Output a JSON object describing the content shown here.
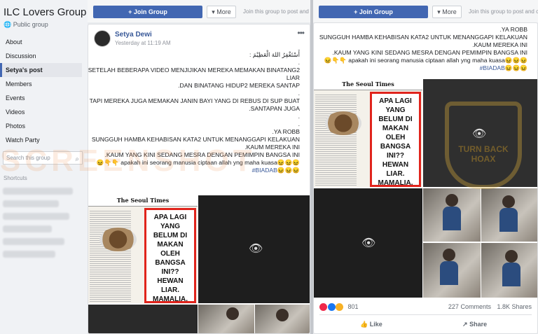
{
  "sidebar": {
    "group_title": "ILC Lovers Group",
    "public_label": "Public group",
    "nav": [
      "About",
      "Discussion",
      "Setya's post",
      "Members",
      "Events",
      "Videos",
      "Photos",
      "Watch Party"
    ],
    "search_placeholder": "Search this group",
    "shortcuts_label": "Shortcuts"
  },
  "topbar": {
    "join_label": "+ Join Group",
    "more_label": "More",
    "join_note": "Join this group to post and co"
  },
  "post": {
    "author": "Setya Dewi",
    "time": "Yesterday at 11:19 AM",
    "lines": [
      ": أَسْتَغْفِرُ اللهَ الْعَظِيْمَ",
      ".",
      "SETELAH BEBERAPA VIDEO MENJIJIKAN MEREKA MEMAKAN BINATANG2",
      "LIAR",
      ".DAN BINATANG HIDUP2 MEREKA SANTAP",
      ".",
      "TAPI MEREKA JUGA MEMAKAN JANIN BAYI YANG DI REBUS DI SUP BUAT",
      ".SANTAPAN JUGA",
      ".",
      ".",
      ".YA ROBB",
      "SUNGGUH HAMBA KEHABISAN KATA2 UNTUK MENANGGAPI KELAKUAN",
      ".KAUM MEREKA INI",
      ".KAUM YANG KINI SEDANG MESRA DENGAN PEMIMPIN BANGSA INI",
      "😖👇👇 apakah ini seorang manusia ciptaan allah yng maha kuasa😖😖😖",
      "#BIADAB😖😖😖"
    ],
    "right_lines": [
      ".YA ROBB",
      "SUNGGUH HAMBA KEHABISAN KATA2 UNTUK MENANGGAPI KELAKUAN",
      ".KAUM MEREKA INI",
      ".KAUM YANG KINI SEDANG MESRA DENGAN PEMIMPIN BANGSA INI",
      "😖👇👇 apakah ini seorang manusia ciptaan allah yng maha kuasa😖😖😖",
      "#BIADAB😖😖😖"
    ],
    "image_masthead": "The Seoul Times",
    "image_caption": "APA LAGI YANG BELUM DI MAKAN OLEH BANGSA INI?? HEWAN LIAR. MAMALIA. KINI JANIN CALON ANAK MANUSIA JUGA DI SANTAPNYA",
    "reaction_count": "801",
    "comments": "227 Comments",
    "shares": "1.8K Shares",
    "like_label": "Like",
    "share_label": "Share"
  },
  "overlays": {
    "watermark": "SCREENSHOT",
    "stamp_text": "TURN BACK HOAX"
  },
  "colors": {
    "brand": "#4267b2",
    "link": "#385898",
    "caption_border": "#e0241c"
  }
}
